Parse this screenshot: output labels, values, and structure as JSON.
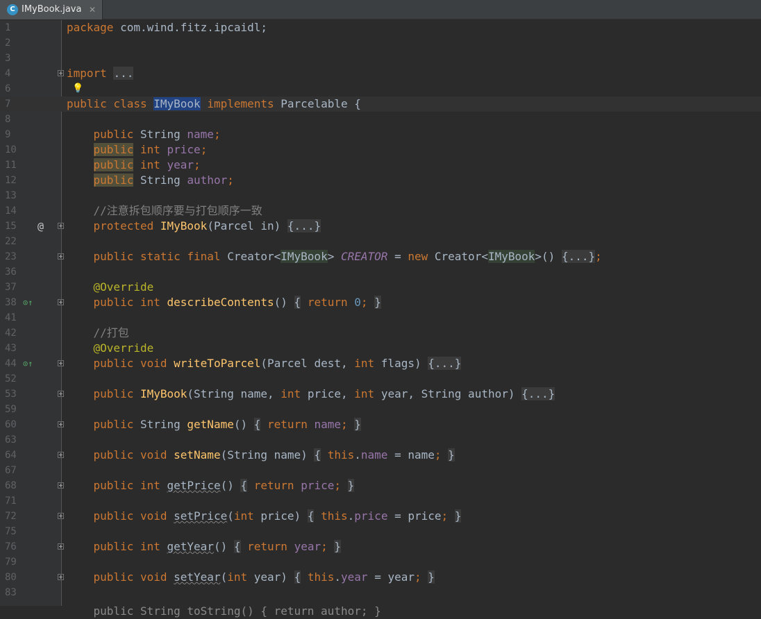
{
  "tab": {
    "file_name": "IMyBook.java",
    "file_type_glyph": "C"
  },
  "gutter_icons": {
    "line6": "bulb-icon",
    "line15": "at-sign-icon",
    "line38": "implements-method-icon",
    "line44": "implements-method-icon"
  },
  "gutter_glyphs": {
    "at": "@",
    "bulb": "💡",
    "impl": "⊙↑"
  },
  "code": {
    "l1_kw": "package",
    "l1_pkg": "com.wind.fitz.ipcaidl;",
    "l4_kw": "import",
    "l4_fold": "...",
    "l7_a": "public class",
    "l7_cls": "IMyBook",
    "l7_b": "implements",
    "l7_c": "Parcelable {",
    "public": "public",
    "String": "String",
    "int": "int",
    "semi": ";",
    "f_name": "name",
    "f_price": "price",
    "f_year": "year",
    "f_author": "author",
    "l14_comment": "//注意拆包顺序要与打包顺序一致",
    "l15_kw": "protected",
    "l15_fn": "IMyBook",
    "l15_params": "(Parcel in)",
    "fold_braces": "{...}",
    "l23_kw": "public static final",
    "l23_a": "Creator<",
    "l23_gen": "IMyBook",
    "l23_b": ">",
    "l23_const": "CREATOR",
    "l23_eq": "=",
    "l23_new": "new",
    "l23_c": "Creator<",
    "l23_d": ">()",
    "override": "@Override",
    "l38_fn": "describeContents",
    "parens": "()",
    "open_brace": "{",
    "close_brace": "}",
    "return_kw": "return",
    "zero": "0",
    "l42_comment": "//打包",
    "void": "void",
    "l44_fn": "writeToParcel",
    "l44_p1": "(Parcel dest,",
    "l44_p2": "flags)",
    "l53_fn": "IMyBook",
    "l53_p1": "(String name,",
    "l53_p2": "price,",
    "l53_p3": "year,",
    "l53_p4": "String author)",
    "l60_fn": "getName",
    "l64_fn": "setName",
    "l64_params": "(String name)",
    "this_kw": "this",
    "dot": ".",
    "l64_rhs": "= name",
    "l68_fn": "getPrice",
    "l72_fn": "setPrice",
    "l72_p_open": "(",
    "l72_p_close": "price)",
    "l72_rhs": "= price",
    "l76_fn": "getYear",
    "l80_fn": "setYear",
    "l80_p_close": "year)",
    "l80_rhs": "= year",
    "l85_partial": "public String toString() { return author; }"
  }
}
